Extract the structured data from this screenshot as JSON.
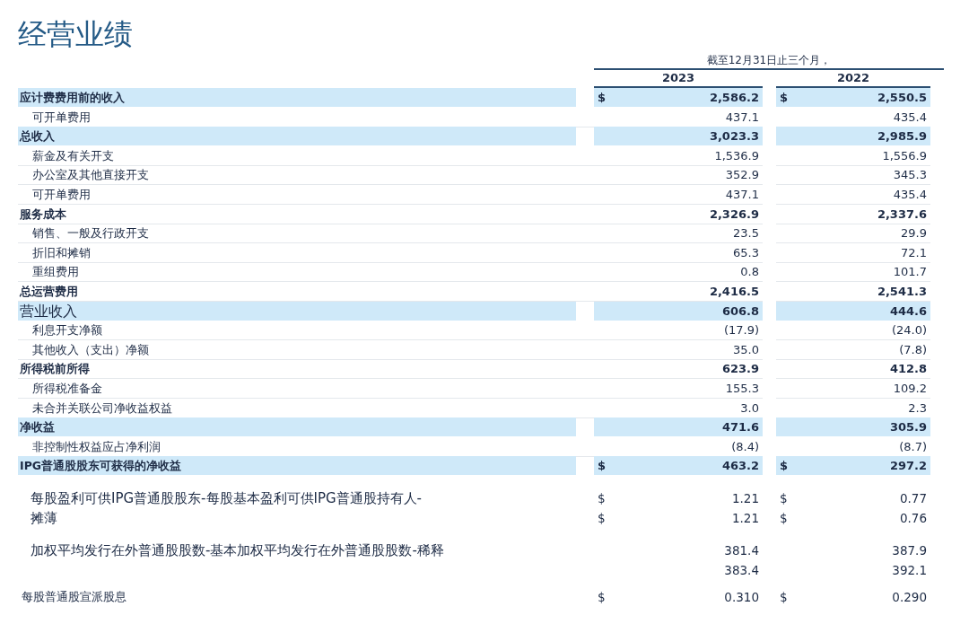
{
  "title": "经营业绩",
  "period": "截至12月31日止三个月，",
  "years": [
    "2023",
    "2022"
  ],
  "rows": [
    {
      "label": "应计费费用前的收入",
      "kind": "total",
      "highlighted": true,
      "values": [
        {
          "currency": "$",
          "value": "2,586.2"
        },
        {
          "currency": "$",
          "value": "2,550.5"
        }
      ]
    },
    {
      "label": "可开单费用",
      "kind": "item",
      "highlighted": false,
      "values": [
        {
          "value": "437.1"
        },
        {
          "value": "435.4"
        }
      ]
    },
    {
      "label": "总收入",
      "kind": "total",
      "highlighted": true,
      "values": [
        {
          "value": "3,023.3"
        },
        {
          "value": "2,985.9"
        }
      ]
    },
    {
      "label": "薪金及有关开支",
      "kind": "item",
      "highlighted": false,
      "values": [
        {
          "value": "1,536.9"
        },
        {
          "value": "1,556.9"
        }
      ]
    },
    {
      "label": "办公室及其他直接开支",
      "kind": "item",
      "highlighted": false,
      "values": [
        {
          "value": "352.9"
        },
        {
          "value": "345.3"
        }
      ]
    },
    {
      "label": "可开单费用",
      "kind": "item",
      "highlighted": false,
      "values": [
        {
          "value": "437.1"
        },
        {
          "value": "435.4"
        }
      ]
    },
    {
      "label": "服务成本",
      "kind": "total",
      "highlighted": false,
      "values": [
        {
          "value": "2,326.9"
        },
        {
          "value": "2,337.6"
        }
      ]
    },
    {
      "label": "销售、一般及行政开支",
      "kind": "item",
      "highlighted": false,
      "values": [
        {
          "value": "23.5"
        },
        {
          "value": "29.9"
        }
      ]
    },
    {
      "label": "折旧和摊销",
      "kind": "item",
      "highlighted": false,
      "values": [
        {
          "value": "65.3"
        },
        {
          "value": "72.1"
        }
      ]
    },
    {
      "label": "重组费用",
      "kind": "item",
      "highlighted": false,
      "values": [
        {
          "value": "0.8"
        },
        {
          "value": "101.7"
        }
      ]
    },
    {
      "label": "总运营费用",
      "kind": "total",
      "highlighted": false,
      "values": [
        {
          "value": "2,416.5"
        },
        {
          "value": "2,541.3"
        }
      ]
    },
    {
      "label": "营业收入",
      "kind": "major",
      "highlighted": true,
      "values": [
        {
          "value": "606.8"
        },
        {
          "value": "444.6"
        }
      ]
    },
    {
      "label": "利息开支净额",
      "kind": "item",
      "highlighted": false,
      "values": [
        {
          "value": "(17.9)"
        },
        {
          "value": "(24.0)"
        }
      ]
    },
    {
      "label": "其他收入（支出）净额",
      "kind": "item",
      "highlighted": false,
      "values": [
        {
          "value": "35.0"
        },
        {
          "value": "(7.8)"
        }
      ]
    },
    {
      "label": "所得税前所得",
      "kind": "total",
      "highlighted": false,
      "values": [
        {
          "value": "623.9"
        },
        {
          "value": "412.8"
        }
      ]
    },
    {
      "label": "所得税准备金",
      "kind": "item",
      "highlighted": false,
      "values": [
        {
          "value": "155.3"
        },
        {
          "value": "109.2"
        }
      ]
    },
    {
      "label": "未合并关联公司净收益权益",
      "kind": "item",
      "highlighted": false,
      "values": [
        {
          "value": "3.0"
        },
        {
          "value": "2.3"
        }
      ]
    },
    {
      "label": "净收益",
      "kind": "total",
      "highlighted": true,
      "values": [
        {
          "value": "471.6"
        },
        {
          "value": "305.9"
        }
      ]
    },
    {
      "label": "非控制性权益应占净利润",
      "kind": "item",
      "highlighted": false,
      "values": [
        {
          "value": "(8.4)"
        },
        {
          "value": "(8.7)"
        }
      ]
    },
    {
      "label": "IPG普通股股东可获得的净收益",
      "kind": "total",
      "highlighted": true,
      "values": [
        {
          "currency": "$",
          "value": "463.2"
        },
        {
          "currency": "$",
          "value": "297.2"
        }
      ]
    }
  ],
  "per_share": [
    {
      "kind": "large",
      "lines": [
        {
          "label": "每股盈利可供IPG普通股股东-每股基本盈利可供IPG普通股持有人-",
          "values": [
            {
              "currency": "$",
              "value": "1.21"
            },
            {
              "currency": "$",
              "value": "0.77"
            }
          ]
        },
        {
          "label": "摊薄",
          "values": [
            {
              "currency": "$",
              "value": "1.21"
            },
            {
              "currency": "$",
              "value": "0.76"
            }
          ]
        }
      ]
    },
    {
      "kind": "large",
      "lines": [
        {
          "label": "加权平均发行在外普通股股数-基本加权平均发行在外普通股股数-稀释",
          "values": [
            {
              "value": "381.4"
            },
            {
              "value": "387.9"
            }
          ]
        },
        {
          "values": [
            {
              "value": "383.4"
            },
            {
              "value": "392.1"
            }
          ]
        }
      ]
    },
    {
      "kind": "small",
      "lines": [
        {
          "label": "每股普通股宣派股息",
          "values": [
            {
              "currency": "$",
              "value": "0.310"
            },
            {
              "currency": "$",
              "value": "0.290"
            }
          ]
        }
      ]
    }
  ]
}
